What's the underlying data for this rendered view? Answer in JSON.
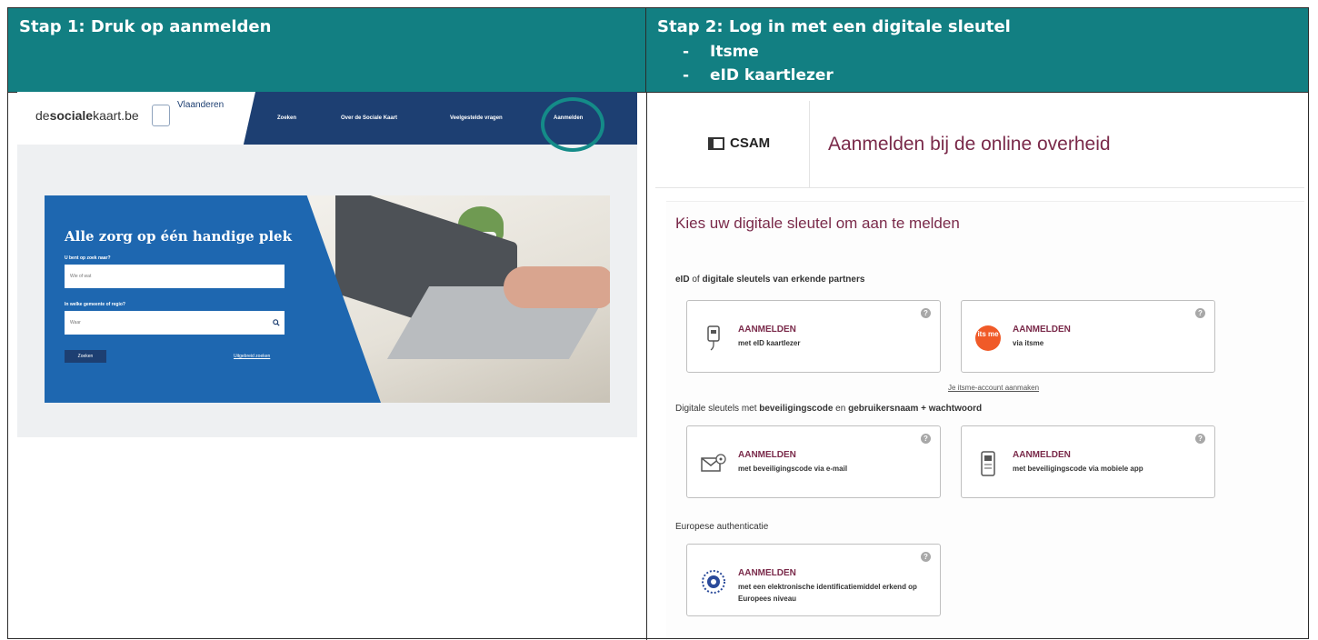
{
  "steps": {
    "step1_title": "Stap 1: Druk op aanmelden",
    "step2_title": "Stap 2: Log in met een digitale sleutel",
    "step2_items": [
      "Itsme",
      "eID kaartlezer"
    ]
  },
  "left_screen": {
    "logo_prefix": "de",
    "logo_bold": "sociale",
    "logo_suffix": "kaart.be",
    "partner_logo": "Vlaanderen",
    "nav": [
      "Zoeken",
      "Over de Sociale Kaart",
      "Veelgestelde vragen",
      "Aanmelden"
    ],
    "hero_title": "Alle zorg op één handige plek",
    "label_what": "U bent op zoek naar?",
    "placeholder_what": "Wie of wat",
    "label_where": "In welke gemeente of regio?",
    "placeholder_where": "Waar",
    "search_button": "Zoeken",
    "advanced_link": "Uitgebreid zoeken"
  },
  "right_screen": {
    "brand": "CSAM",
    "title": "Aanmelden bij de online overheid",
    "subtitle": "Kies uw digitale sleutel om aan te melden",
    "section1": {
      "a": "eID",
      "of": " of ",
      "b": "digitale sleutels van erkende partners"
    },
    "section2": {
      "a": "Digitale sleutels met ",
      "b": "beveiligingscode",
      "c": " en ",
      "d": "gebruikersnaam + wachtwoord"
    },
    "section3": "Europese authenticatie",
    "itsme_account_link": "Je itsme-account aanmaken",
    "cards": [
      {
        "title": "AANMELDEN",
        "desc": "met eID kaartlezer",
        "icon": "card-reader-icon"
      },
      {
        "title": "AANMELDEN",
        "desc": "via itsme",
        "icon": "itsme-icon"
      },
      {
        "title": "AANMELDEN",
        "desc": "met beveiligingscode via e-mail",
        "icon": "email-icon"
      },
      {
        "title": "AANMELDEN",
        "desc": "met beveiligingscode via mobiele app",
        "icon": "mobile-app-icon"
      },
      {
        "title": "AANMELDEN",
        "desc": "met een elektronische identificatiemiddel erkend op Europees niveau",
        "icon": "eu-identity-icon"
      }
    ],
    "help_glyph": "?",
    "itsme_icon_text": "its me"
  },
  "colors": {
    "header_bg": "#127f82",
    "accent": "#7a2a4a",
    "nav_bg": "#1d3f72",
    "hero_blue": "#1e67b0",
    "highlight_ring": "#148b88"
  }
}
